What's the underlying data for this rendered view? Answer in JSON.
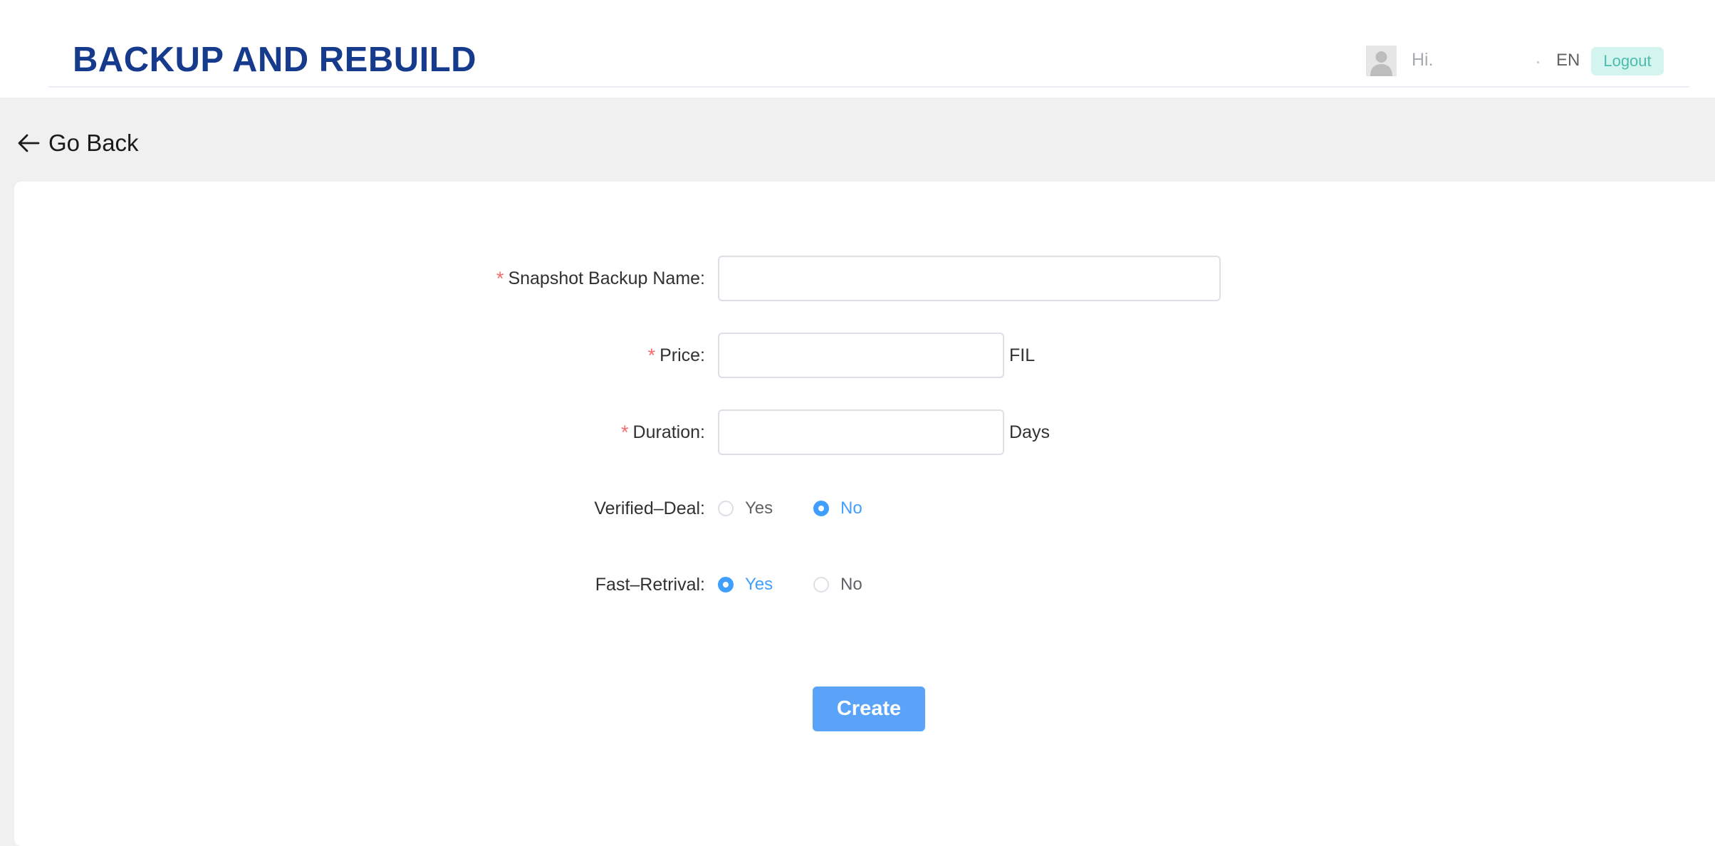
{
  "header": {
    "title": "BACKUP AND REBUILD",
    "greeting": "Hi.",
    "language": "EN",
    "logout_label": "Logout",
    "avatar_icon": "user-avatar-icon"
  },
  "nav": {
    "go_back_label": "Go Back",
    "go_back_icon": "arrow-left-icon"
  },
  "form": {
    "snapshot_name": {
      "label": "Snapshot Backup Name:",
      "required": true,
      "value": "",
      "placeholder": ""
    },
    "price": {
      "label": "Price:",
      "required": true,
      "value": "",
      "placeholder": "",
      "unit": "FIL"
    },
    "duration": {
      "label": "Duration:",
      "required": true,
      "value": "",
      "placeholder": "",
      "unit": "Days"
    },
    "verified_deal": {
      "label": "Verified–Deal:",
      "options": [
        {
          "label": "Yes",
          "checked": false
        },
        {
          "label": "No",
          "checked": true
        }
      ]
    },
    "fast_retrival": {
      "label": "Fast–Retrival:",
      "options": [
        {
          "label": "Yes",
          "checked": true
        },
        {
          "label": "No",
          "checked": false
        }
      ]
    },
    "required_mark": "*",
    "create_label": "Create"
  },
  "colors": {
    "title": "#163a8c",
    "primary": "#409eff",
    "button": "#5aa3f8",
    "required": "#f56c6c",
    "logout_bg": "#d4f4ef",
    "logout_text": "#4dbbad",
    "page_bg": "#f0f0f0"
  }
}
